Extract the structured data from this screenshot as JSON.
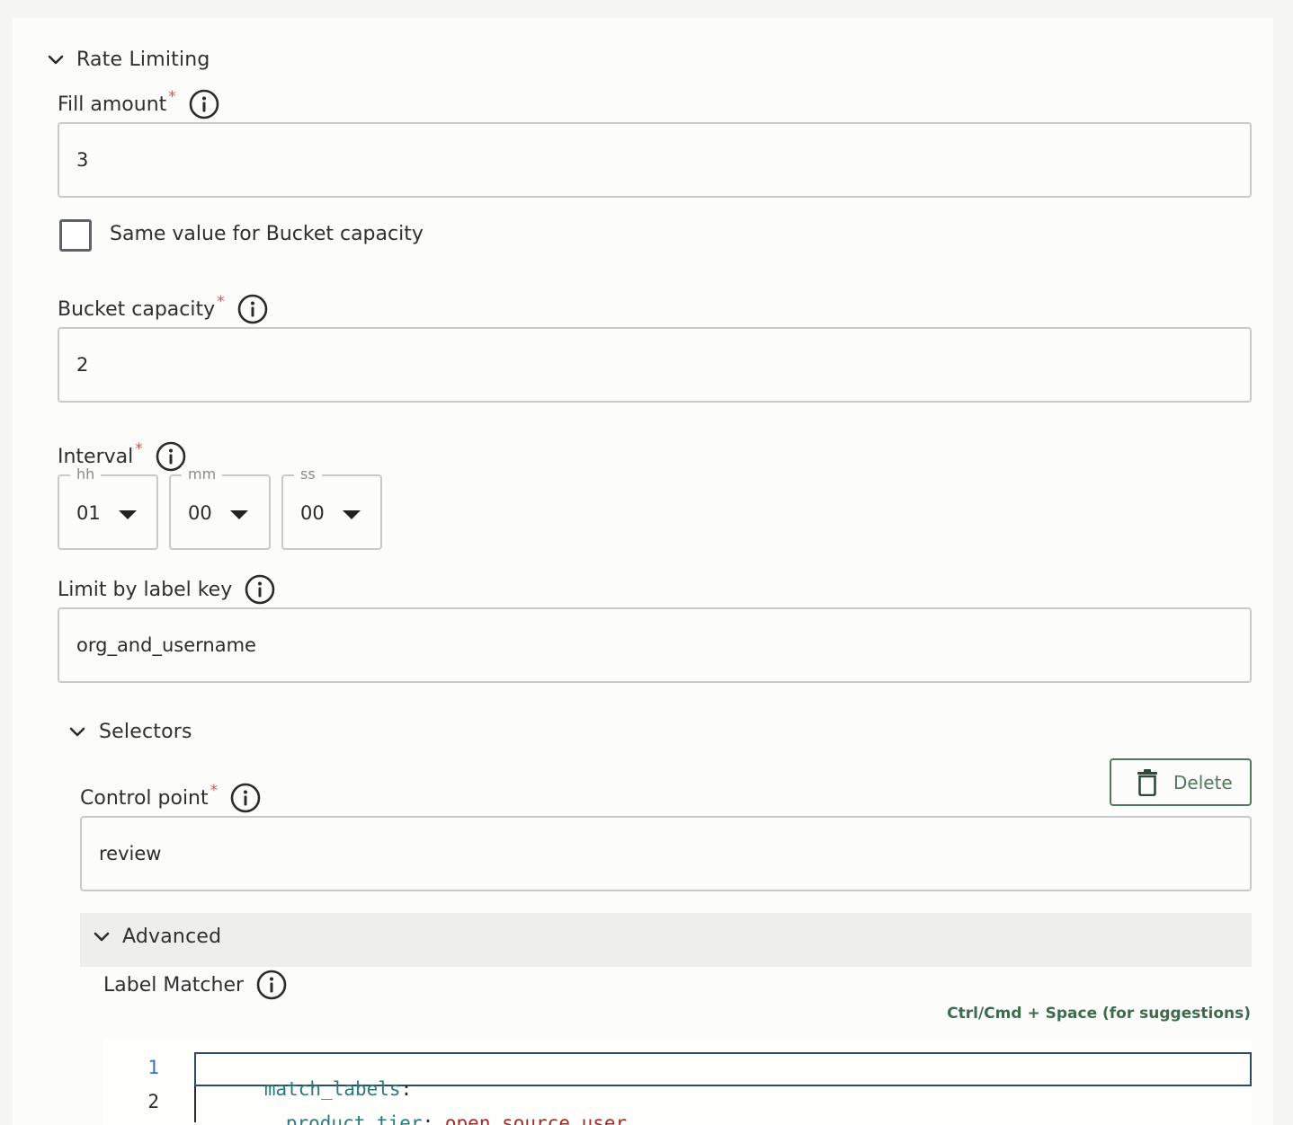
{
  "rate_limiting": {
    "section_title": "Rate Limiting",
    "fill_amount": {
      "label": "Fill amount",
      "required_mark": "*",
      "value": "3"
    },
    "same_value_checkbox": {
      "label": "Same value for Bucket capacity",
      "checked": false
    },
    "bucket_capacity": {
      "label": "Bucket capacity",
      "required_mark": "*",
      "value": "2"
    },
    "interval": {
      "label": "Interval",
      "required_mark": "*",
      "hours": {
        "legend": "hh",
        "value": "01"
      },
      "minutes": {
        "legend": "mm",
        "value": "00"
      },
      "seconds": {
        "legend": "ss",
        "value": "00"
      }
    },
    "limit_by_label_key": {
      "label": "Limit by label key",
      "value": "org_and_username"
    }
  },
  "selectors": {
    "section_title": "Selectors",
    "delete_label": "Delete",
    "control_point": {
      "label": "Control point",
      "required_mark": "*",
      "value": "review"
    },
    "advanced": {
      "section_title": "Advanced",
      "label_matcher": {
        "label": "Label Matcher"
      },
      "hint": "Ctrl/Cmd + Space (for suggestions)",
      "editor": {
        "line_numbers": [
          "1",
          "2"
        ],
        "line1": {
          "key": "match_labels",
          "colon": ":"
        },
        "line2": {
          "key": "product_tier",
          "colon": ":",
          "value": "open_source_user"
        }
      }
    }
  },
  "icons": {
    "chevron": "chevron-down-icon",
    "info": "info-icon",
    "caret": "caret-down-icon",
    "trash": "trash-icon"
  },
  "colors": {
    "required": "#d9534f",
    "accent_green": "#4f7a5e",
    "code_key": "#2d7a7a",
    "code_value": "#9b2d2d",
    "active_line_number": "#3b6fc4"
  }
}
